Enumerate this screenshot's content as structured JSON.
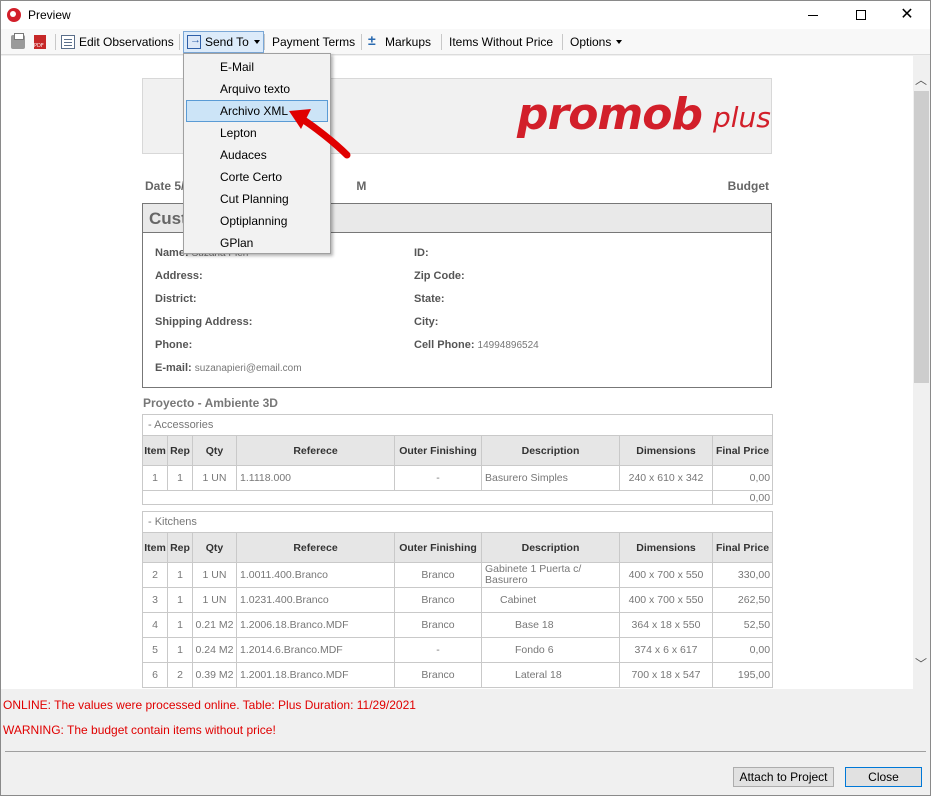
{
  "window": {
    "title": "Preview"
  },
  "toolbar": {
    "edit_observations": "Edit Observations",
    "send_to": "Send To",
    "payment_terms": "Payment Terms",
    "markups": "Markups",
    "items_without_price": "Items Without Price",
    "options": "Options",
    "icons": [
      "print-icon",
      "pdf-icon",
      "edit-icon",
      "send-icon",
      "markup-icon"
    ]
  },
  "send_to_menu": {
    "items": [
      "E-Mail",
      "Arquivo texto",
      "Archivo XML",
      "Lepton",
      "Audaces",
      "Corte Certo",
      "Cut Planning",
      "Optiplanning",
      "GPlan"
    ],
    "highlighted": "Archivo XML"
  },
  "document": {
    "logo": {
      "word": "promob",
      "plus": "plus",
      "color": "#d21f2a"
    },
    "date_label": "Date 5/",
    "date_tail": "M",
    "doc_type": "Budget",
    "customer_title": "Cust",
    "fields": {
      "name_label": "Name:",
      "name_value": "Suzana Pieri",
      "address_label": "Address:",
      "district_label": "District:",
      "shipping_label": "Shipping Address:",
      "phone_label": "Phone:",
      "email_label": "E-mail:",
      "email_value": "suzanapieri@email.com",
      "id_label": "ID:",
      "zip_label": "Zip Code:",
      "state_label": "State:",
      "city_label": "City:",
      "cell_label": "Cell Phone:",
      "cell_value": "14994896524"
    },
    "project_title": "Proyecto - Ambiente 3D",
    "columns": [
      "Item",
      "Rep",
      "Qty",
      "Referece",
      "Outer Finishing",
      "Description",
      "Dimensions",
      "Final Price"
    ],
    "sections": [
      {
        "name": "- Accessories",
        "rows": [
          [
            "1",
            "1",
            "1 UN",
            "1.1118.000",
            "-",
            "Basurero Simples",
            "240 x 610 x 342",
            "0,00"
          ]
        ],
        "total": "0,00"
      },
      {
        "name": "- Kitchens",
        "rows": [
          [
            "2",
            "1",
            "1 UN",
            "1.0011.400.Branco",
            "Branco",
            "Gabinete 1 Puerta c/ Basurero",
            "400 x 700 x 550",
            "330,00"
          ],
          [
            "3",
            "1",
            "1 UN",
            "1.0231.400.Branco",
            "Branco",
            "Cabinet",
            "400 x 700 x 550",
            "262,50"
          ],
          [
            "4",
            "1",
            "0.21 M2",
            "1.2006.18.Branco.MDF",
            "Branco",
            "Base 18",
            "364 x 18 x 550",
            "52,50"
          ],
          [
            "5",
            "1",
            "0.24 M2",
            "1.2014.6.Branco.MDF",
            "-",
            "Fondo 6",
            "374 x 6 x 617",
            "0,00"
          ],
          [
            "6",
            "2",
            "0.39 M2",
            "1.2001.18.Branco.MDF",
            "Branco",
            "Lateral 18",
            "700 x 18 x 547",
            "195,00"
          ]
        ]
      }
    ]
  },
  "status": {
    "online_msg": "ONLINE: The values were processed online. Table: Plus Duration: 11/29/2021",
    "warning_msg": "WARNING: The budget contain items without price!",
    "color": "#e00000"
  },
  "buttons": {
    "attach": "Attach to Project",
    "close": "Close"
  }
}
